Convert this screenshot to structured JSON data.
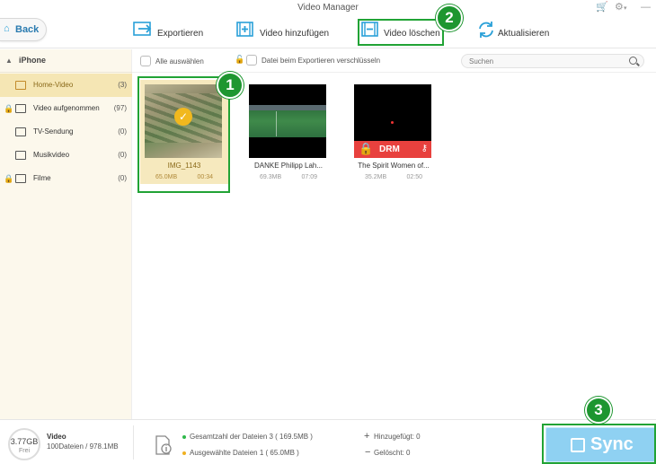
{
  "window": {
    "title": "Video Manager",
    "icons": [
      "cart-icon",
      "gear-icon",
      "minimize-icon"
    ]
  },
  "toolbar": {
    "back_label": "Back",
    "export_label": "Exportieren",
    "add_label": "Video hinzufügen",
    "delete_label": "Video löschen",
    "refresh_label": "Aktualisieren"
  },
  "sidebar": {
    "device": "iPhone",
    "items": [
      {
        "label": "Home-Video",
        "count": "(3)",
        "active": true,
        "locked": false
      },
      {
        "label": "Video aufgenommen",
        "count": "(97)",
        "active": false,
        "locked": true
      },
      {
        "label": "TV-Sendung",
        "count": "(0)",
        "active": false,
        "locked": false
      },
      {
        "label": "Musikvideo",
        "count": "(0)",
        "active": false,
        "locked": false
      },
      {
        "label": "Filme",
        "count": "(0)",
        "active": false,
        "locked": true
      }
    ]
  },
  "filter": {
    "select_all_label": "Alle auswählen",
    "encrypt_label": "Datei beim Exportieren verschlüsseln",
    "search_placeholder": "Suchen"
  },
  "videos": [
    {
      "name": "IMG_1143",
      "size": "65.0MB",
      "duration": "00:34",
      "selected": true
    },
    {
      "name": "DANKE Philipp Lah...",
      "size": "69.3MB",
      "duration": "07:09",
      "selected": false
    },
    {
      "name": "The Spirit Women of...",
      "size": "35.2MB",
      "duration": "02:50",
      "selected": false,
      "drm_label": "DRM"
    }
  ],
  "status": {
    "storage_value": "3.77GB",
    "storage_free_label": "Frei",
    "category": "Video",
    "category_detail": "100Dateien / 978.1MB",
    "total_files": "Gesamtzahl der Dateien 3 ( 169.5MB )",
    "selected_files": "Ausgewählte Dateien 1 ( 65.0MB )",
    "added": "Hinzugefügt: 0",
    "deleted": "Gelöscht: 0",
    "total_dot_color": "#2eb84a",
    "selected_dot_color": "#f0b020"
  },
  "sync_label": "Sync",
  "annotations": {
    "step1": "1",
    "step2": "2",
    "step3": "3",
    "highlight_color": "#21a335"
  },
  "colors": {
    "accent": "#2aa0d8",
    "sidebar_bg": "#fcf8ec",
    "sidebar_active": "#f5e6b4",
    "sync_bg": "#8fd1f2",
    "drm_bg": "#e8413e"
  }
}
